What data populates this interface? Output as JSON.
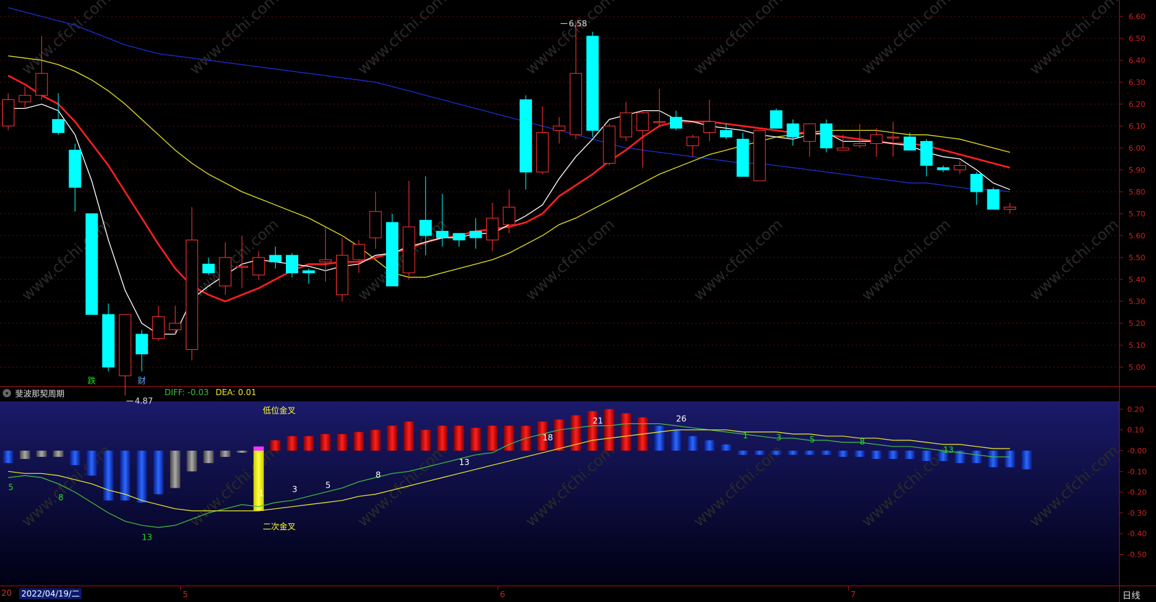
{
  "price_panel": {
    "y_axis": {
      "min": 4.8,
      "max": 6.7,
      "ticks": [
        5.0,
        5.1,
        5.2,
        5.3,
        5.4,
        5.5,
        5.6,
        5.7,
        5.8,
        5.9,
        6.0,
        6.1,
        6.2,
        6.3,
        6.4,
        6.5,
        6.6
      ],
      "tick_labels": [
        "5.00",
        "5.10",
        "5.20",
        "5.30",
        "5.40",
        "5.50",
        "5.60",
        "5.70",
        "5.80",
        "5.90",
        "6.00",
        "6.10",
        "6.20",
        "6.30",
        "6.40",
        "6.50",
        "6.60"
      ]
    },
    "high_marker": {
      "label": "6.58",
      "index": 33,
      "value": 6.58
    },
    "low_marker": {
      "label": "4.87",
      "index": 7,
      "value": 4.87
    },
    "event_labels": [
      {
        "text": "跌",
        "index": 5,
        "color": "#22dd22"
      },
      {
        "text": "财",
        "index": 8,
        "color": "#66aaff"
      }
    ]
  },
  "indicator_panel": {
    "title": "斐波那契周期",
    "diff_label": "DIFF:",
    "diff_value": "-0.03",
    "dea_label": "DEA:",
    "dea_value": "0.01",
    "y_axis": {
      "min": -0.6,
      "max": 0.25,
      "ticks": [
        0.2,
        0.1,
        0.0,
        -0.1,
        -0.2,
        -0.3,
        -0.4,
        -0.5
      ],
      "tick_labels": [
        "0.20",
        "0.10",
        "-0.00",
        "-0.10",
        "-0.20",
        "-0.30",
        "-0.40",
        "-0.50"
      ]
    },
    "annotations": [
      {
        "text": "低位金叉",
        "index": 15,
        "value": 0.18,
        "color": "#ffff33"
      },
      {
        "text": "二次金叉",
        "index": 15,
        "value": -0.38,
        "color": "#ffff33"
      }
    ],
    "fib_labels": [
      {
        "text": "5",
        "index": 0,
        "value": -0.19,
        "color": "#22dd22"
      },
      {
        "text": "8",
        "index": 3,
        "value": -0.24,
        "color": "#22dd22"
      },
      {
        "text": "13",
        "index": 8,
        "value": -0.43,
        "color": "#22dd22"
      },
      {
        "text": "1",
        "index": 15,
        "value": -0.22,
        "color": "#ffffff"
      },
      {
        "text": "3",
        "index": 17,
        "value": -0.2,
        "color": "#ffffff"
      },
      {
        "text": "5",
        "index": 19,
        "value": -0.18,
        "color": "#ffffff"
      },
      {
        "text": "8",
        "index": 22,
        "value": -0.13,
        "color": "#ffffff"
      },
      {
        "text": "13",
        "index": 27,
        "value": -0.07,
        "color": "#ffffff"
      },
      {
        "text": "18",
        "index": 32,
        "value": 0.05,
        "color": "#ffffff"
      },
      {
        "text": "21",
        "index": 35,
        "value": 0.13,
        "color": "#ffffff"
      },
      {
        "text": "26",
        "index": 40,
        "value": 0.14,
        "color": "#ffffff"
      },
      {
        "text": "1",
        "index": 44,
        "value": 0.06,
        "color": "#22dd22"
      },
      {
        "text": "3",
        "index": 46,
        "value": 0.05,
        "color": "#22dd22"
      },
      {
        "text": "5",
        "index": 48,
        "value": 0.04,
        "color": "#22dd22"
      },
      {
        "text": "8",
        "index": 51,
        "value": 0.03,
        "color": "#22dd22"
      },
      {
        "text": "13",
        "index": 56,
        "value": -0.01,
        "color": "#22dd22"
      }
    ]
  },
  "x_axis": {
    "date_left": "20",
    "cursor_date": "2022/04/19/二",
    "month_labels": [
      {
        "text": "5",
        "index": 10
      },
      {
        "text": "6",
        "index": 29
      },
      {
        "text": "7",
        "index": 50
      }
    ],
    "period_label": "日线"
  },
  "watermark": "www.cfchi.com",
  "colors": {
    "up": "#ff3333",
    "down": "#00ffff",
    "ma5": "#ffffff",
    "ma10": "#ff2020",
    "ma20": "#e0e020",
    "ma60": "#1a2dcc",
    "macd_pos": "#ff1010",
    "macd_neg": "#1a4dff",
    "macd_gray": "#888888",
    "diff": "#44bb44",
    "dea": "#e8e830"
  },
  "chart_data": [
    {
      "type": "candlestick",
      "title": "",
      "ylim": [
        4.8,
        6.7
      ],
      "candles": [
        {
          "o": 6.1,
          "h": 6.25,
          "l": 6.08,
          "c": 6.22
        },
        {
          "o": 6.21,
          "h": 6.28,
          "l": 6.18,
          "c": 6.24
        },
        {
          "o": 6.24,
          "h": 6.51,
          "l": 6.22,
          "c": 6.34
        },
        {
          "o": 6.13,
          "h": 6.25,
          "l": 6.06,
          "c": 6.07
        },
        {
          "o": 5.99,
          "h": 6.02,
          "l": 5.71,
          "c": 5.82
        },
        {
          "o": 5.7,
          "h": 5.7,
          "l": 5.24,
          "c": 5.24
        },
        {
          "o": 5.24,
          "h": 5.29,
          "l": 4.98,
          "c": 5.0
        },
        {
          "o": 4.96,
          "h": 5.24,
          "l": 4.87,
          "c": 5.24
        },
        {
          "o": 5.15,
          "h": 5.17,
          "l": 4.98,
          "c": 5.06
        },
        {
          "o": 5.13,
          "h": 5.28,
          "l": 5.12,
          "c": 5.23
        },
        {
          "o": 5.17,
          "h": 5.28,
          "l": 5.15,
          "c": 5.2
        },
        {
          "o": 5.08,
          "h": 5.73,
          "l": 5.03,
          "c": 5.58
        },
        {
          "o": 5.47,
          "h": 5.5,
          "l": 5.42,
          "c": 5.43
        },
        {
          "o": 5.37,
          "h": 5.57,
          "l": 5.33,
          "c": 5.5
        },
        {
          "o": 5.46,
          "h": 5.6,
          "l": 5.36,
          "c": 5.46
        },
        {
          "o": 5.42,
          "h": 5.53,
          "l": 5.4,
          "c": 5.5
        },
        {
          "o": 5.51,
          "h": 5.55,
          "l": 5.45,
          "c": 5.48
        },
        {
          "o": 5.51,
          "h": 5.52,
          "l": 5.41,
          "c": 5.43
        },
        {
          "o": 5.44,
          "h": 5.45,
          "l": 5.38,
          "c": 5.43
        },
        {
          "o": 5.48,
          "h": 5.64,
          "l": 5.39,
          "c": 5.49
        },
        {
          "o": 5.33,
          "h": 5.59,
          "l": 5.3,
          "c": 5.51
        },
        {
          "o": 5.49,
          "h": 5.58,
          "l": 5.43,
          "c": 5.56
        },
        {
          "o": 5.59,
          "h": 5.8,
          "l": 5.54,
          "c": 5.71
        },
        {
          "o": 5.66,
          "h": 5.7,
          "l": 5.37,
          "c": 5.37
        },
        {
          "o": 5.43,
          "h": 5.85,
          "l": 5.4,
          "c": 5.64
        },
        {
          "o": 5.67,
          "h": 5.87,
          "l": 5.51,
          "c": 5.6
        },
        {
          "o": 5.62,
          "h": 5.79,
          "l": 5.55,
          "c": 5.59
        },
        {
          "o": 5.61,
          "h": 5.61,
          "l": 5.55,
          "c": 5.58
        },
        {
          "o": 5.62,
          "h": 5.68,
          "l": 5.54,
          "c": 5.59
        },
        {
          "o": 5.58,
          "h": 5.75,
          "l": 5.53,
          "c": 5.68
        },
        {
          "o": 5.65,
          "h": 5.81,
          "l": 5.61,
          "c": 5.73
        },
        {
          "o": 6.22,
          "h": 6.24,
          "l": 5.81,
          "c": 5.89
        },
        {
          "o": 5.89,
          "h": 6.19,
          "l": 5.88,
          "c": 6.07
        },
        {
          "o": 6.08,
          "h": 6.14,
          "l": 6.02,
          "c": 6.1
        },
        {
          "o": 6.06,
          "h": 6.58,
          "l": 6.04,
          "c": 6.34
        },
        {
          "o": 6.51,
          "h": 6.53,
          "l": 6.05,
          "c": 6.08
        },
        {
          "o": 5.93,
          "h": 6.11,
          "l": 5.92,
          "c": 6.1
        },
        {
          "o": 6.05,
          "h": 6.21,
          "l": 6.03,
          "c": 6.16
        },
        {
          "o": 6.08,
          "h": 6.17,
          "l": 5.91,
          "c": 6.16
        },
        {
          "o": 6.12,
          "h": 6.27,
          "l": 6.1,
          "c": 6.12
        },
        {
          "o": 6.14,
          "h": 6.17,
          "l": 6.08,
          "c": 6.09
        },
        {
          "o": 6.01,
          "h": 6.06,
          "l": 5.96,
          "c": 6.05
        },
        {
          "o": 6.07,
          "h": 6.22,
          "l": 6.03,
          "c": 6.12
        },
        {
          "o": 6.08,
          "h": 6.11,
          "l": 6.04,
          "c": 6.05
        },
        {
          "o": 6.04,
          "h": 6.07,
          "l": 5.87,
          "c": 5.87
        },
        {
          "o": 5.85,
          "h": 6.08,
          "l": 5.85,
          "c": 6.08
        },
        {
          "o": 6.17,
          "h": 6.18,
          "l": 6.09,
          "c": 6.09
        },
        {
          "o": 6.11,
          "h": 6.13,
          "l": 6.01,
          "c": 6.05
        },
        {
          "o": 6.03,
          "h": 6.11,
          "l": 5.96,
          "c": 6.11
        },
        {
          "o": 6.11,
          "h": 6.13,
          "l": 5.98,
          "c": 6.0
        },
        {
          "o": 5.99,
          "h": 6.06,
          "l": 5.99,
          "c": 6.0
        },
        {
          "o": 6.01,
          "h": 6.11,
          "l": 6.0,
          "c": 6.02
        },
        {
          "o": 6.02,
          "h": 6.09,
          "l": 5.96,
          "c": 6.06
        },
        {
          "o": 6.05,
          "h": 6.12,
          "l": 5.96,
          "c": 6.05
        },
        {
          "o": 6.05,
          "h": 6.07,
          "l": 5.99,
          "c": 5.99
        },
        {
          "o": 6.03,
          "h": 6.04,
          "l": 5.87,
          "c": 5.92
        },
        {
          "o": 5.91,
          "h": 5.92,
          "l": 5.89,
          "c": 5.9
        },
        {
          "o": 5.9,
          "h": 5.94,
          "l": 5.88,
          "c": 5.92
        },
        {
          "o": 5.88,
          "h": 5.89,
          "l": 5.74,
          "c": 5.8
        },
        {
          "o": 5.81,
          "h": 5.82,
          "l": 5.72,
          "c": 5.72
        },
        {
          "o": 5.72,
          "h": 5.75,
          "l": 5.7,
          "c": 5.73
        }
      ],
      "ma": [
        {
          "color": "ma60",
          "values": [
            6.64,
            6.62,
            6.6,
            6.58,
            6.56,
            6.53,
            6.5,
            6.47,
            6.45,
            6.43,
            6.42,
            6.41,
            6.4,
            6.39,
            6.38,
            6.37,
            6.36,
            6.35,
            6.34,
            6.33,
            6.32,
            6.31,
            6.3,
            6.28,
            6.26,
            6.24,
            6.22,
            6.2,
            6.18,
            6.16,
            6.14,
            6.12,
            6.1,
            6.08,
            6.06,
            6.04,
            6.02,
            6.0,
            5.99,
            5.98,
            5.97,
            5.96,
            5.95,
            5.94,
            5.93,
            5.93,
            5.92,
            5.91,
            5.9,
            5.89,
            5.88,
            5.87,
            5.86,
            5.85,
            5.84,
            5.84,
            5.83,
            5.82,
            5.81,
            5.81,
            5.8
          ]
        },
        {
          "color": "ma20",
          "values": [
            6.42,
            6.41,
            6.4,
            6.38,
            6.35,
            6.31,
            6.26,
            6.2,
            6.13,
            6.06,
            5.99,
            5.93,
            5.88,
            5.84,
            5.8,
            5.77,
            5.74,
            5.71,
            5.68,
            5.64,
            5.6,
            5.55,
            5.49,
            5.43,
            5.41,
            5.41,
            5.43,
            5.45,
            5.47,
            5.49,
            5.52,
            5.56,
            5.6,
            5.65,
            5.68,
            5.72,
            5.76,
            5.8,
            5.84,
            5.88,
            5.91,
            5.94,
            5.97,
            5.99,
            6.01,
            6.03,
            6.05,
            6.06,
            6.07,
            6.08,
            6.08,
            6.08,
            6.08,
            6.07,
            6.06,
            6.06,
            6.05,
            6.04,
            6.02,
            6.0,
            5.98
          ]
        },
        {
          "color": "ma10",
          "values": [
            6.33,
            6.29,
            6.24,
            6.2,
            6.12,
            6.02,
            5.92,
            5.8,
            5.68,
            5.56,
            5.45,
            5.37,
            5.33,
            5.3,
            5.33,
            5.36,
            5.4,
            5.44,
            5.47,
            5.47,
            5.48,
            5.48,
            5.5,
            5.52,
            5.54,
            5.57,
            5.59,
            5.6,
            5.62,
            5.63,
            5.64,
            5.66,
            5.7,
            5.78,
            5.83,
            5.88,
            5.94,
            5.99,
            6.05,
            6.1,
            6.12,
            6.12,
            6.12,
            6.11,
            6.1,
            6.09,
            6.08,
            6.07,
            6.07,
            6.06,
            6.05,
            6.04,
            6.03,
            6.02,
            6.02,
            6.01,
            5.99,
            5.97,
            5.95,
            5.93,
            5.91
          ]
        },
        {
          "color": "ma5",
          "values": [
            6.18,
            6.18,
            6.2,
            6.17,
            6.06,
            5.85,
            5.58,
            5.35,
            5.2,
            5.15,
            5.15,
            5.31,
            5.37,
            5.42,
            5.47,
            5.49,
            5.48,
            5.47,
            5.46,
            5.44,
            5.46,
            5.47,
            5.51,
            5.52,
            5.55,
            5.57,
            5.59,
            5.59,
            5.61,
            5.61,
            5.65,
            5.69,
            5.74,
            5.86,
            5.96,
            6.04,
            6.13,
            6.15,
            6.17,
            6.17,
            6.13,
            6.12,
            6.1,
            6.09,
            6.08,
            6.06,
            6.05,
            6.04,
            6.06,
            6.07,
            6.03,
            6.03,
            6.03,
            6.02,
            6.01,
            5.98,
            5.96,
            5.95,
            5.9,
            5.84,
            5.81
          ]
        }
      ]
    },
    {
      "type": "bar",
      "title": "",
      "ylim": [
        -0.6,
        0.25
      ],
      "macd_histogram": [
        -0.06,
        -0.04,
        -0.03,
        -0.03,
        -0.07,
        -0.12,
        -0.24,
        -0.24,
        -0.25,
        -0.21,
        -0.18,
        -0.1,
        -0.06,
        -0.03,
        -0.01,
        -0.29,
        0.05,
        0.07,
        0.07,
        0.08,
        0.08,
        0.09,
        0.1,
        0.12,
        0.14,
        0.1,
        0.12,
        0.12,
        0.11,
        0.12,
        0.12,
        0.12,
        0.14,
        0.15,
        0.17,
        0.19,
        0.2,
        0.18,
        0.16,
        0.12,
        0.1,
        0.07,
        0.05,
        0.03,
        -0.02,
        -0.02,
        -0.02,
        -0.02,
        -0.02,
        -0.02,
        -0.03,
        -0.03,
        -0.04,
        -0.04,
        -0.04,
        -0.05,
        -0.05,
        -0.06,
        -0.06,
        -0.08,
        -0.08,
        -0.09
      ],
      "bar_style": [
        "neg",
        "gray",
        "gray",
        "gray",
        "neg",
        "neg",
        "neg",
        "neg",
        "neg",
        "neg",
        "gray",
        "gray",
        "gray",
        "gray",
        "gray",
        "cross",
        "pos",
        "pos",
        "pos",
        "pos",
        "pos",
        "pos",
        "pos",
        "pos",
        "pos",
        "pos",
        "pos",
        "pos",
        "pos",
        "pos",
        "pos",
        "pos",
        "pos",
        "pos",
        "pos",
        "pos",
        "pos",
        "pos",
        "pos",
        "neg",
        "neg",
        "neg",
        "neg",
        "neg",
        "neg",
        "neg",
        "neg",
        "neg",
        "neg",
        "neg",
        "neg",
        "neg",
        "neg",
        "neg",
        "neg",
        "neg",
        "neg",
        "neg",
        "neg",
        "neg",
        "neg",
        "neg"
      ],
      "diff": [
        -0.13,
        -0.12,
        -0.13,
        -0.16,
        -0.2,
        -0.25,
        -0.3,
        -0.34,
        -0.36,
        -0.37,
        -0.36,
        -0.33,
        -0.3,
        -0.28,
        -0.26,
        -0.27,
        -0.25,
        -0.24,
        -0.22,
        -0.2,
        -0.18,
        -0.15,
        -0.13,
        -0.11,
        -0.1,
        -0.08,
        -0.06,
        -0.04,
        -0.02,
        -0.01,
        0.03,
        0.06,
        0.08,
        0.1,
        0.11,
        0.12,
        0.12,
        0.13,
        0.13,
        0.13,
        0.12,
        0.11,
        0.1,
        0.09,
        0.08,
        0.07,
        0.06,
        0.06,
        0.05,
        0.05,
        0.04,
        0.04,
        0.03,
        0.02,
        0.02,
        0.01,
        0.0,
        -0.01,
        -0.02,
        -0.03,
        -0.03
      ],
      "dea": [
        -0.1,
        -0.11,
        -0.11,
        -0.12,
        -0.14,
        -0.16,
        -0.19,
        -0.21,
        -0.24,
        -0.26,
        -0.28,
        -0.29,
        -0.29,
        -0.29,
        -0.29,
        -0.29,
        -0.28,
        -0.27,
        -0.26,
        -0.25,
        -0.24,
        -0.22,
        -0.21,
        -0.19,
        -0.17,
        -0.15,
        -0.13,
        -0.11,
        -0.09,
        -0.07,
        -0.05,
        -0.03,
        -0.01,
        0.01,
        0.03,
        0.05,
        0.06,
        0.07,
        0.08,
        0.09,
        0.1,
        0.1,
        0.1,
        0.1,
        0.09,
        0.09,
        0.09,
        0.08,
        0.08,
        0.07,
        0.07,
        0.06,
        0.06,
        0.05,
        0.05,
        0.04,
        0.03,
        0.03,
        0.02,
        0.01,
        0.01
      ]
    }
  ]
}
